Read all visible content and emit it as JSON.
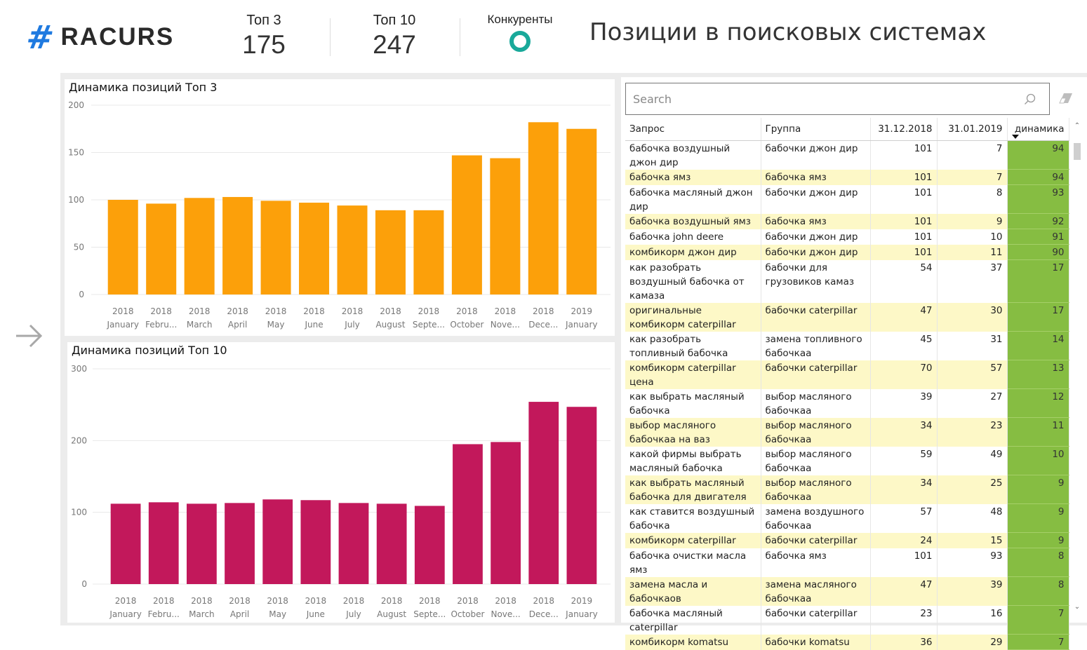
{
  "header": {
    "logo_symbol": "#",
    "logo_text": "RACURS",
    "kpis": [
      {
        "label": "Топ 3",
        "value": "175"
      },
      {
        "label": "Топ 10",
        "value": "247"
      },
      {
        "label": "Конкуренты",
        "value": ""
      }
    ],
    "title": "Позиции в поисковых системах"
  },
  "nav": {
    "next_icon": "arrow-right-icon"
  },
  "colors": {
    "brand": "#1f7ae0",
    "top3_bar": "#fca00a",
    "top10_bar": "#c2185b",
    "competitors_ring": "#19a99a",
    "row_highlight": "#fdf8c7",
    "dynamics_cell": "#86bd42"
  },
  "chart_data": [
    {
      "type": "bar",
      "title": "Динамика позиций Топ 3",
      "categories": [
        {
          "year": "2018",
          "month": "January"
        },
        {
          "year": "2018",
          "month": "Febru..."
        },
        {
          "year": "2018",
          "month": "March"
        },
        {
          "year": "2018",
          "month": "April"
        },
        {
          "year": "2018",
          "month": "May"
        },
        {
          "year": "2018",
          "month": "June"
        },
        {
          "year": "2018",
          "month": "July"
        },
        {
          "year": "2018",
          "month": "August"
        },
        {
          "year": "2018",
          "month": "Septe..."
        },
        {
          "year": "2018",
          "month": "October"
        },
        {
          "year": "2018",
          "month": "Nove..."
        },
        {
          "year": "2018",
          "month": "Dece..."
        },
        {
          "year": "2019",
          "month": "January"
        }
      ],
      "values": [
        100,
        96,
        102,
        103,
        99,
        97,
        94,
        89,
        89,
        147,
        144,
        182,
        175
      ],
      "yticks": [
        0,
        50,
        100,
        150,
        200
      ],
      "ylim": [
        0,
        200
      ],
      "xlabel": "",
      "ylabel": "",
      "grid": true,
      "color": "#fca00a"
    },
    {
      "type": "bar",
      "title": "Динамика позиций Топ 10",
      "categories": [
        {
          "year": "2018",
          "month": "January"
        },
        {
          "year": "2018",
          "month": "Febru..."
        },
        {
          "year": "2018",
          "month": "March"
        },
        {
          "year": "2018",
          "month": "April"
        },
        {
          "year": "2018",
          "month": "May"
        },
        {
          "year": "2018",
          "month": "June"
        },
        {
          "year": "2018",
          "month": "July"
        },
        {
          "year": "2018",
          "month": "August"
        },
        {
          "year": "2018",
          "month": "Septe..."
        },
        {
          "year": "2018",
          "month": "October"
        },
        {
          "year": "2018",
          "month": "Nove..."
        },
        {
          "year": "2018",
          "month": "Dece..."
        },
        {
          "year": "2019",
          "month": "January"
        }
      ],
      "values": [
        112,
        114,
        112,
        113,
        118,
        117,
        113,
        112,
        109,
        195,
        198,
        254,
        247
      ],
      "yticks": [
        0,
        100,
        200,
        300
      ],
      "ylim": [
        0,
        300
      ],
      "xlabel": "",
      "ylabel": "",
      "grid": true,
      "color": "#c2185b"
    }
  ],
  "table": {
    "search_placeholder": "Search",
    "search_value": "",
    "columns": [
      "Запрос",
      "Группа",
      "31.12.2018",
      "31.01.2019",
      "динамика"
    ],
    "sort_column": "динамика",
    "sort_direction": "desc",
    "rows": [
      [
        "бабочка воздушный джон дир",
        "бабочки джон дир",
        "101",
        "7",
        "94"
      ],
      [
        "бабочка ямз",
        "бабочка ямз",
        "101",
        "7",
        "94"
      ],
      [
        "бабочка масляный джон дир",
        "бабочки джон дир",
        "101",
        "8",
        "93"
      ],
      [
        "бабочка воздушный ямз",
        "бабочка ямз",
        "101",
        "9",
        "92"
      ],
      [
        "бабочка john deere",
        "бабочки джон дир",
        "101",
        "10",
        "91"
      ],
      [
        "комбикорм джон дир",
        "бабочки джон дир",
        "101",
        "11",
        "90"
      ],
      [
        "как разобрать воздушный бабочка от камаза",
        "бабочки для грузовиков камаз",
        "54",
        "37",
        "17"
      ],
      [
        "оригинальные комбикорм caterpillar",
        "бабочки caterpillar",
        "47",
        "30",
        "17"
      ],
      [
        "как разобрать топливный бабочка",
        "замена топливного бабочкаа",
        "45",
        "31",
        "14"
      ],
      [
        "комбикорм caterpillar цена",
        "бабочки caterpillar",
        "70",
        "57",
        "13"
      ],
      [
        "как выбрать масляный бабочка",
        "выбор масляного бабочкаа",
        "39",
        "27",
        "12"
      ],
      [
        "выбор масляного бабочкаа на ваз",
        "выбор масляного бабочкаа",
        "34",
        "23",
        "11"
      ],
      [
        "какой фирмы выбрать масляный бабочка",
        "выбор масляного бабочкаа",
        "59",
        "49",
        "10"
      ],
      [
        "как выбрать масляный бабочка для двигателя",
        "выбор масляного бабочкаа",
        "34",
        "25",
        "9"
      ],
      [
        "как ставится воздушный бабочка",
        "замена воздушного бабочкаа",
        "57",
        "48",
        "9"
      ],
      [
        "комбикорм caterpillar",
        "бабочки caterpillar",
        "24",
        "15",
        "9"
      ],
      [
        "бабочка очистки масла ямз",
        "бабочка ямз",
        "101",
        "93",
        "8"
      ],
      [
        "замена масла и бабочкаов",
        "замена масляного бабочкаа",
        "47",
        "39",
        "8"
      ],
      [
        "бабочка масляный caterpillar",
        "бабочки caterpillar",
        "23",
        "16",
        "7"
      ],
      [
        "комбикорм komatsu",
        "бабочки komatsu",
        "36",
        "29",
        "7"
      ]
    ]
  }
}
